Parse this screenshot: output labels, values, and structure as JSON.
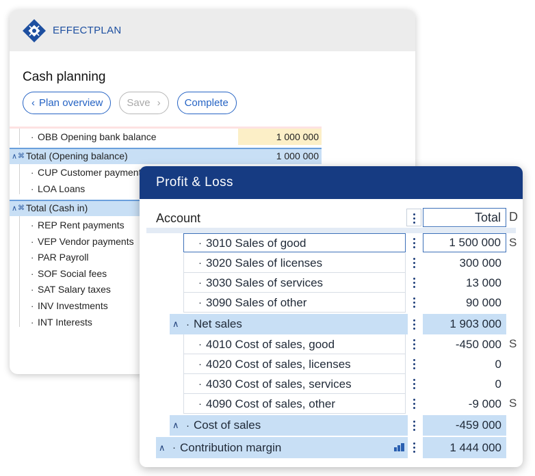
{
  "brand": {
    "name": "EFFECTPLAN",
    "accent": "#1d4fa0"
  },
  "cash_planning": {
    "title": "Cash planning",
    "buttons": {
      "back": "Plan overview",
      "save": "Save",
      "complete": "Complete"
    },
    "rows": [
      {
        "label": "OBB Opening bank balance",
        "value": "1 000 000"
      },
      {
        "label": "Total (Opening balance)",
        "value": "1 000 000"
      },
      {
        "label": "CUP Customer payments"
      },
      {
        "label": "LOA Loans"
      },
      {
        "label": "Total (Cash in)"
      },
      {
        "label": "REP Rent payments"
      },
      {
        "label": "VEP Vendor payments"
      },
      {
        "label": "PAR Payroll"
      },
      {
        "label": "SOF Social fees"
      },
      {
        "label": "SAT Salary taxes"
      },
      {
        "label": "INV Investments"
      },
      {
        "label": "INT Interests"
      }
    ]
  },
  "profit_loss": {
    "title": "Profit & Loss",
    "columns": {
      "account": "Account",
      "total": "Total",
      "next": "D"
    },
    "rows": [
      {
        "label": "3010 Sales of good",
        "value": "1 500 000",
        "trail": "S"
      },
      {
        "label": "3020 Sales of licenses",
        "value": "300 000"
      },
      {
        "label": "3030 Sales of services",
        "value": "13 000"
      },
      {
        "label": "3090 Sales of other",
        "value": "90 000"
      },
      {
        "label": "Net sales",
        "value": "1 903 000"
      },
      {
        "label": "4010 Cost of sales, good",
        "value": "-450 000",
        "trail": "S"
      },
      {
        "label": "4020 Cost of sales, licenses",
        "value": "0"
      },
      {
        "label": "4030 Cost of sales, services",
        "value": "0"
      },
      {
        "label": "4090 Cost of sales, other",
        "value": "-9 000",
        "trail": "S"
      },
      {
        "label": "Cost of sales",
        "value": "-459 000"
      },
      {
        "label": "Contribution margin",
        "value": "1 444 000"
      }
    ]
  }
}
